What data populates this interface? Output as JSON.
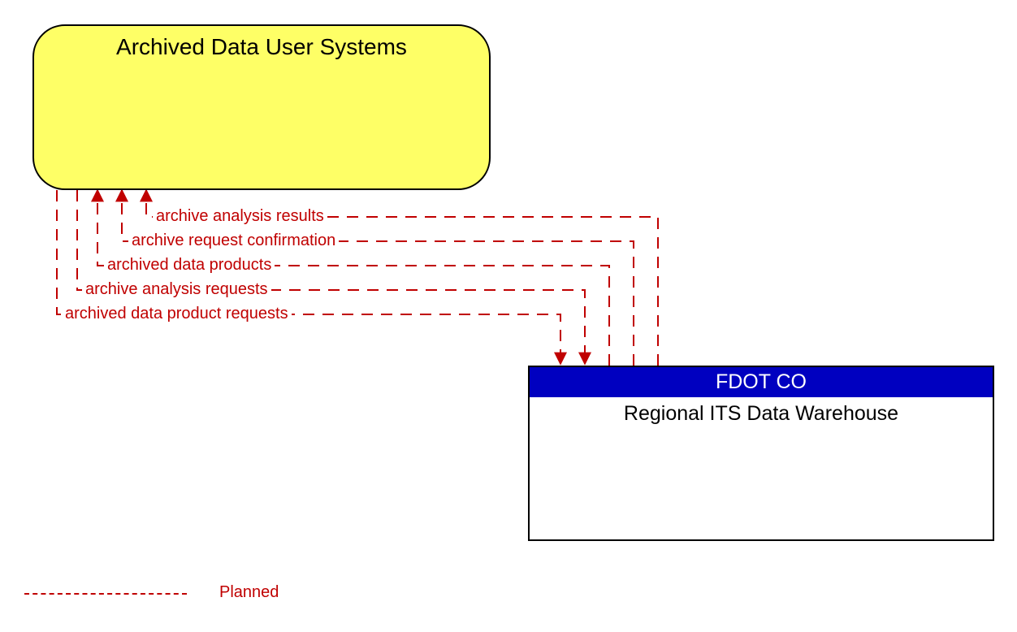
{
  "nodes": {
    "source": {
      "title": "Archived Data User Systems"
    },
    "target": {
      "owner": "FDOT CO",
      "name": "Regional ITS Data Warehouse"
    }
  },
  "flows": {
    "f1": "archive analysis results",
    "f2": "archive request confirmation",
    "f3": "archived data products",
    "f4": "archive analysis requests",
    "f5": "archived data product requests"
  },
  "legend": {
    "planned": "Planned"
  }
}
